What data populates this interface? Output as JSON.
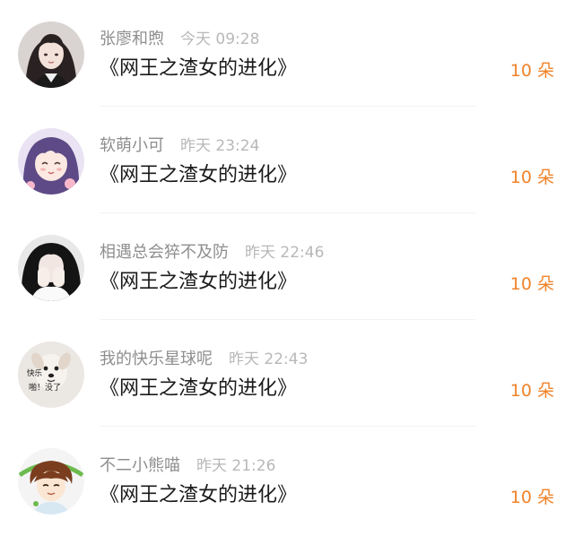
{
  "comments": [
    {
      "user": "张廖和煦",
      "time": "今天 09:28",
      "book": "《网王之渣女的进化》",
      "gift": "10 朵",
      "avatar": "avatar-girl-dark-hair-icon"
    },
    {
      "user": "软萌小可",
      "time": "昨天 23:24",
      "book": "《网王之渣女的进化》",
      "gift": "10 朵",
      "avatar": "avatar-anime-girl-purple-hair-icon"
    },
    {
      "user": "相遇总会猝不及防",
      "time": "昨天 22:46",
      "book": "《网王之渣女的进化》",
      "gift": "10 朵",
      "avatar": "avatar-girl-covering-face-icon"
    },
    {
      "user": "我的快乐星球呢",
      "time": "昨天 22:43",
      "book": "《网王之渣女的进化》",
      "gift": "10 朵",
      "avatar": "avatar-dog-meme-icon"
    },
    {
      "user": "不二小熊喵",
      "time": "昨天 21:26",
      "book": "《网王之渣女的进化》",
      "gift": "10 朵",
      "avatar": "avatar-anime-boy-brown-hair-icon"
    }
  ],
  "avatar_meme_text": [
    "快乐",
    "啪！没了"
  ],
  "colors": {
    "gift": "#f0832a",
    "name": "#8e8e8e",
    "time": "#b8b8b8",
    "book": "#1a1a1a"
  }
}
